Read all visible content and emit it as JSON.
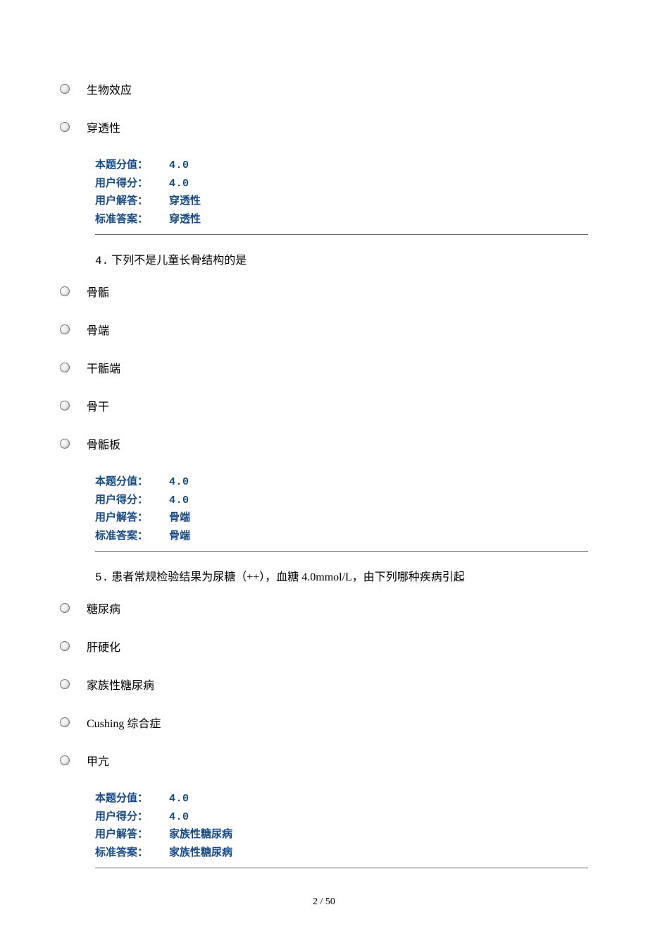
{
  "preOptions": [
    "生物效应",
    "穿透性"
  ],
  "block3": {
    "points_label": "本题分值：",
    "points_value": "4.0",
    "user_score_label": "用户得分：",
    "user_score_value": "4.0",
    "user_answer_label": "用户解答：",
    "user_answer_value": "穿透性",
    "standard_answer_label": "标准答案：",
    "standard_answer_value": "穿透性"
  },
  "question4": {
    "number": "4.",
    "text": "下列不是儿童长骨结构的是",
    "options": [
      "骨骺",
      "骨端",
      "干骺端",
      "骨干",
      "骨骺板"
    ],
    "score": {
      "points_label": "本题分值：",
      "points_value": "4.0",
      "user_score_label": "用户得分：",
      "user_score_value": "4.0",
      "user_answer_label": "用户解答：",
      "user_answer_value": "骨端",
      "standard_answer_label": "标准答案：",
      "standard_answer_value": "骨端"
    }
  },
  "question5": {
    "number": "5.",
    "text": "患者常规检验结果为尿糖（++），血糖 4.0mmol/L，由下列哪种疾病引起",
    "options": [
      "糖尿病",
      "肝硬化",
      "家族性糖尿病",
      "Cushing 综合症",
      "甲亢"
    ],
    "score": {
      "points_label": "本题分值：",
      "points_value": "4.0",
      "user_score_label": "用户得分：",
      "user_score_value": "4.0",
      "user_answer_label": "用户解答：",
      "user_answer_value": "家族性糖尿病",
      "standard_answer_label": "标准答案：",
      "standard_answer_value": "家族性糖尿病"
    }
  },
  "pageNumber": "2 / 50"
}
